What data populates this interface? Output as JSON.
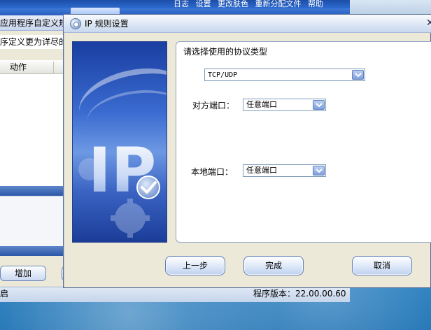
{
  "background": {
    "top_menu_text": "日志 设置 更改肤色 重新分配文件 帮助",
    "app_title": "应用程序自定义规",
    "description": "序定义更为详尽的",
    "column_header": "动作",
    "add_button": "增加",
    "status_left": "启",
    "version": "程序版本：22.00.00.60"
  },
  "dialog": {
    "title": "IP 规则设置",
    "close_glyph": "✕",
    "banner_text": "IP",
    "protocol_label": "请选择使用的协议类型",
    "protocol_value": "TCP/UDP",
    "remote_port_label": "对方端口：",
    "remote_port_value": "任意端口",
    "local_port_label": "本地端口：",
    "local_port_value": "任意端口",
    "buttons": {
      "prev": "上一步",
      "finish": "完成",
      "cancel": "取消"
    }
  },
  "icons": {
    "dialog_icon": "gear-globe-icon",
    "dropdown": "chevron-down-icon",
    "banner_check": "check-icon",
    "banner_gear": "gear-icon"
  },
  "colors": {
    "banner_blue": "#2f5dc0",
    "dialog_bg": "#ece9d8",
    "combo_border": "#7f9db9"
  }
}
